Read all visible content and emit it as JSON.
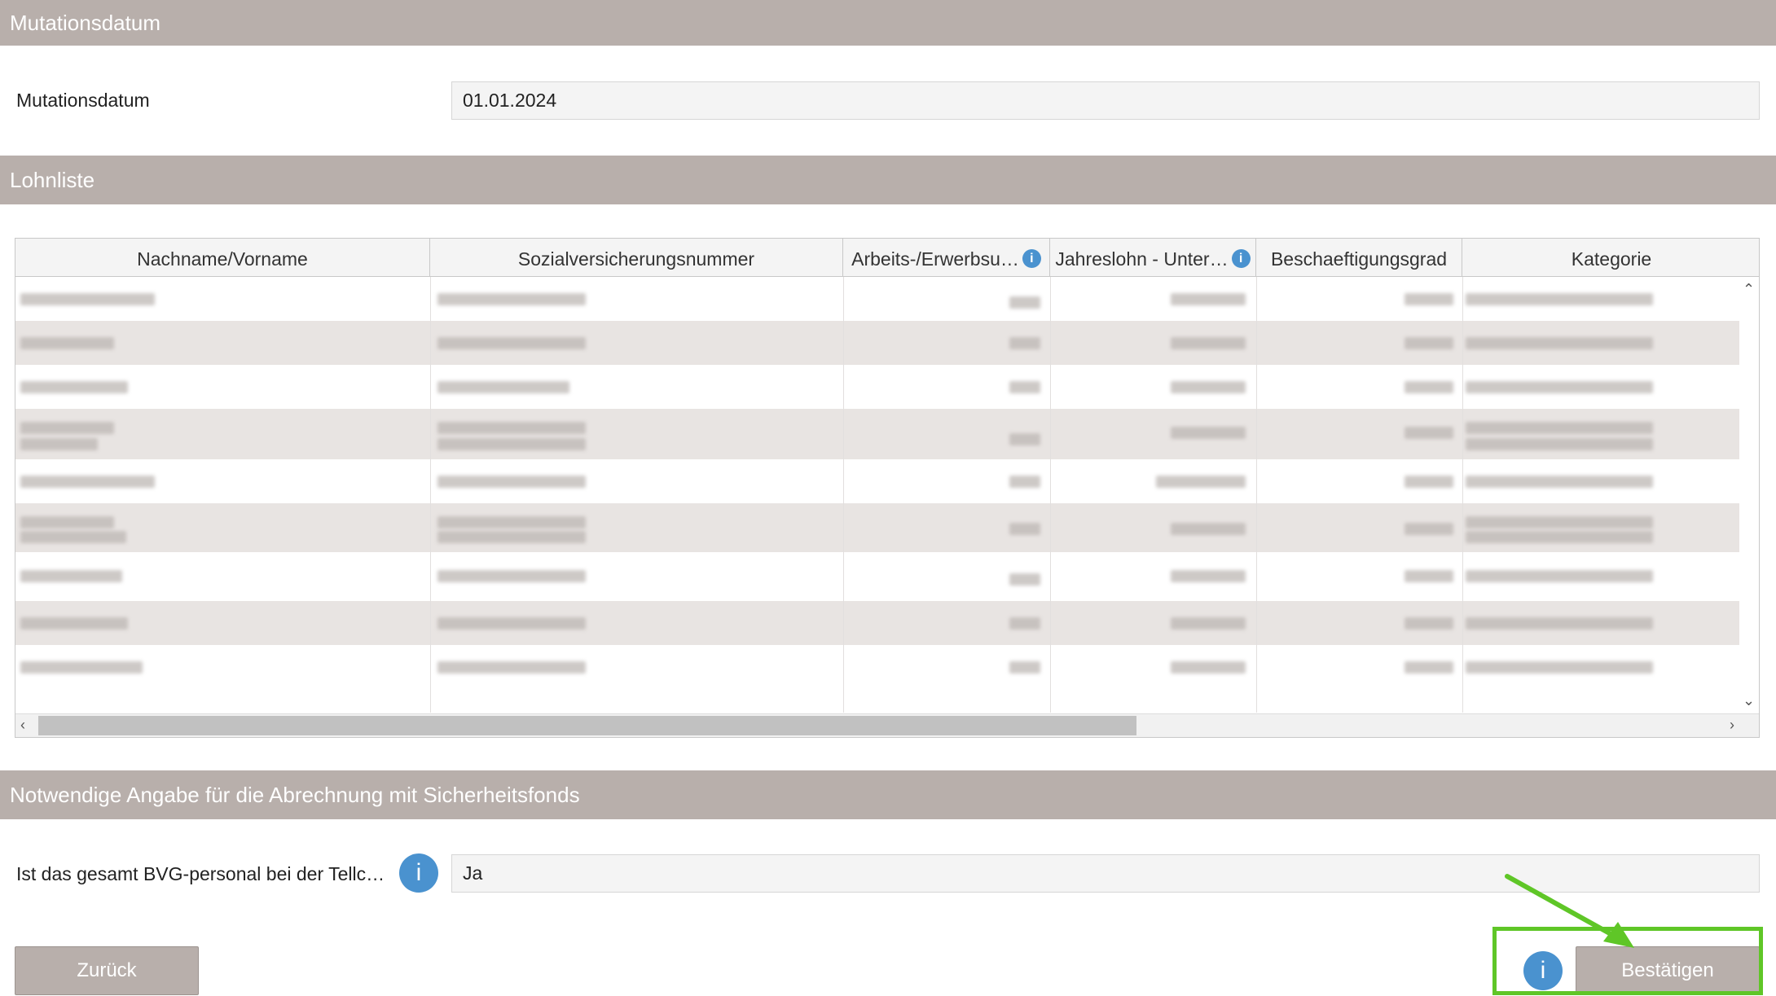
{
  "sections": {
    "mutation_title": "Mutationsdatum",
    "payroll_title": "Lohnliste",
    "required_title": "Notwendige Angabe für die Abrechnung mit Sicherheitsfonds"
  },
  "mutation": {
    "label": "Mutationsdatum",
    "value": "01.01.2024"
  },
  "table": {
    "columns": [
      {
        "label": "Nachname/Vorname"
      },
      {
        "label": "Sozialversicherungsnummer"
      },
      {
        "label": "Arbeits-/Erwerbsu…"
      },
      {
        "label": "Jahreslohn - Unter…"
      },
      {
        "label": "Beschaeftigungsgrad"
      },
      {
        "label": "Kategorie"
      }
    ],
    "row_count": 9
  },
  "required": {
    "label": "Ist das gesamt BVG-personal bei der Tellc…",
    "value": "Ja"
  },
  "buttons": {
    "back": "Zurück",
    "confirm": "Bestätigen",
    "info_glyph": "i"
  },
  "colors": {
    "section_bar": "#b8afab",
    "info_blue": "#4a92cf",
    "highlight_green": "#5fc627"
  }
}
